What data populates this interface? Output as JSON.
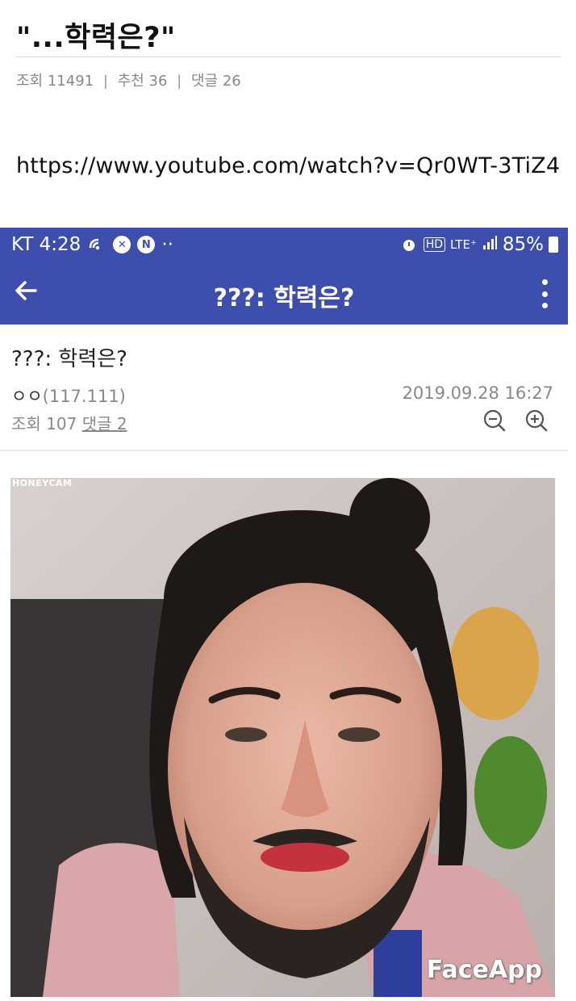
{
  "post": {
    "title": "\"...학력은?\"",
    "views_label": "조회",
    "views": "11491",
    "recommend_label": "추천",
    "recommend": "36",
    "comments_label": "댓글",
    "comments": "26",
    "separator": "|",
    "link": "https://www.youtube.com/watch?v=Qr0WT-3TiZ4"
  },
  "phone": {
    "status_left": "KT 4:28",
    "status_dots": "··",
    "status_hd": "HD",
    "status_lte": "LTE⁺",
    "status_signal": "…ıl",
    "status_battery": "85%",
    "app_title": "???: 학력은?",
    "inner_title": "???: 학력은?",
    "author": "ㅇㅇ",
    "author_ip": "(117.111)",
    "date": "2019.09.28 16:27",
    "views_label": "조회",
    "views": "107",
    "comments_label": "댓글 2",
    "watermark_top": "HONEYCAM",
    "watermark_faceapp": "FaceApp"
  },
  "colors": {
    "app_bar": "#3d4eac",
    "meta_gray": "#888888"
  },
  "icons": {
    "back": "arrow-left-icon",
    "more": "vertical-dots-icon",
    "zoom_out": "zoom-out-icon",
    "zoom_in": "zoom-in-icon"
  }
}
